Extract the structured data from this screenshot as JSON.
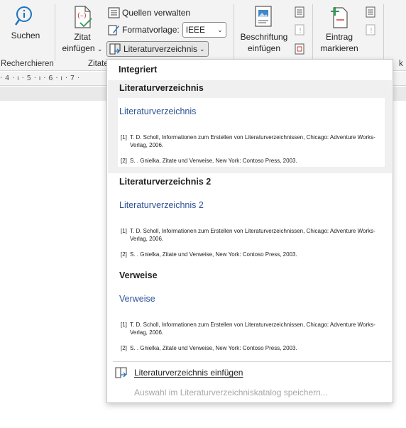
{
  "ribbon": {
    "search_label": "Suchen",
    "research_group": "Recherchieren",
    "cite_insert_label": "Zitat\neinfügen",
    "cite_insert_line1": "Zitat",
    "cite_insert_line2": "einfügen",
    "manage_sources": "Quellen verwalten",
    "style_label": "Formatvorlage:",
    "style_value": "IEEE",
    "bibliography_button": "Literaturverzeichnis",
    "citations_group": "Zitate",
    "caption_line1": "Beschriftung",
    "caption_line2": "einfügen",
    "mark_entry_line1": "Eintrag",
    "mark_entry_line2": "markieren",
    "group_partial_right": "k"
  },
  "ruler": {
    "text": "· 4 · ı · 5 · ı · 6 · ı · 7 ·"
  },
  "dropdown": {
    "heading": "Integriert",
    "items": [
      {
        "title": "Literaturverzeichnis",
        "preview_heading": "Literaturverzeichnis",
        "entry1_num": "[1]",
        "entry1_text": "T. D. Scholl, Informationen zum Erstellen von Literaturverzeichnissen, Chicago: Adventure Works-Verlag, 2006.",
        "entry2_num": "[2]",
        "entry2_text": "S. . Gnielka, Zitate und Verweise, New York: Contoso Press, 2003."
      },
      {
        "title": "Literaturverzeichnis 2",
        "preview_heading": "Literaturverzeichnis 2",
        "entry1_num": "[1]",
        "entry1_text": "T. D. Scholl, Informationen zum Erstellen von Literaturverzeichnissen, Chicago: Adventure Works-Verlag, 2006.",
        "entry2_num": "[2]",
        "entry2_text": "S. . Gnielka, Zitate und Verweise, New York: Contoso Press, 2003."
      },
      {
        "title": "Verweise",
        "preview_heading": "Verweise",
        "entry1_num": "[1]",
        "entry1_text": "T. D. Scholl, Informationen zum Erstellen von Literaturverzeichnissen, Chicago: Adventure Works-Verlag, 2006.",
        "entry2_num": "[2]",
        "entry2_text": "S. . Gnielka, Zitate und Verweise, New York: Contoso Press, 2003."
      }
    ],
    "insert_bibliography": "Literaturverzeichnis einfügen",
    "save_to_gallery": "Auswahl im Literaturverzeichniskatalog speichern..."
  },
  "colors": {
    "accent_blue": "#2f5496",
    "icon_red": "#c0392b",
    "icon_green": "#2e9b4f",
    "icon_blue": "#1e73be"
  }
}
